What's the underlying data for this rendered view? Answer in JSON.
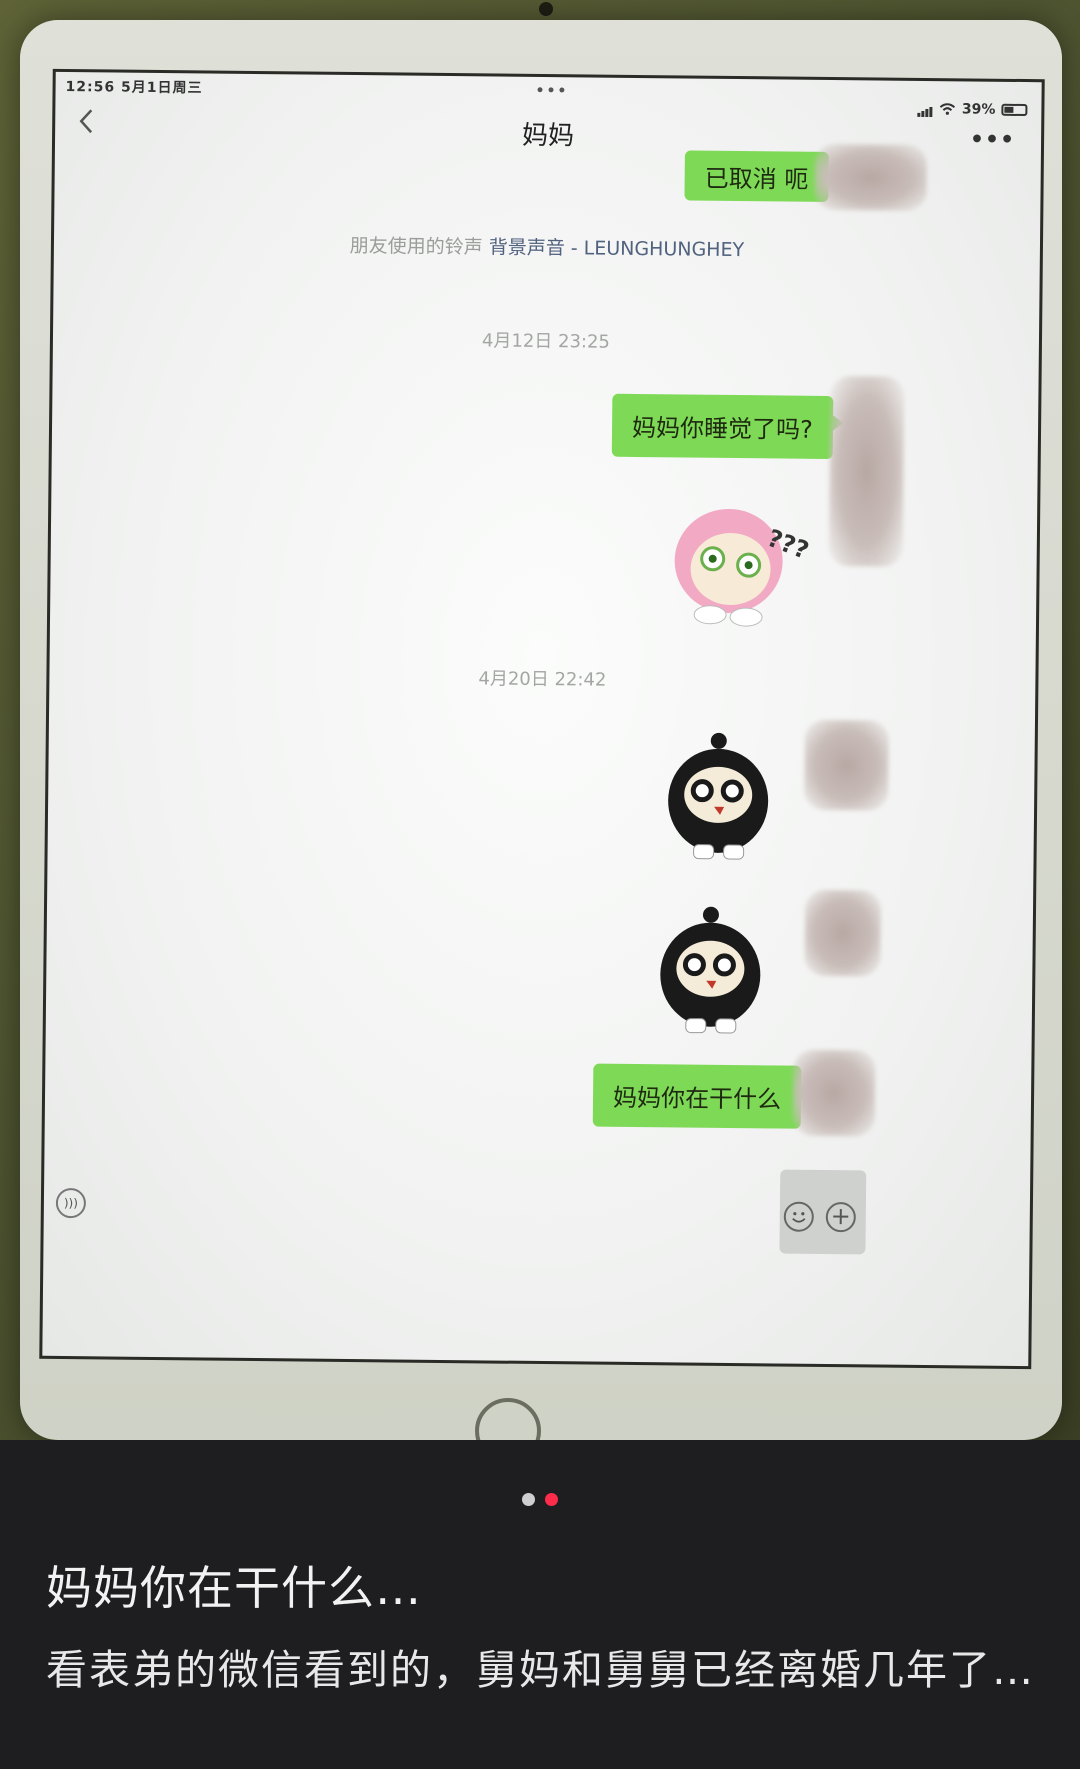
{
  "status_bar": {
    "time": "12:56  5月1日周三",
    "battery": "39%",
    "multitask": "•••"
  },
  "chat": {
    "title": "妈妈",
    "top_bubble": "已取消 呃",
    "system_note_prefix": "朋友使用的铃声",
    "system_note_link": "背景声音 - LEUNGHUNGHEY",
    "timestamp_1": "4月12日 23:25",
    "msg_1": "妈妈你睡觉了吗?",
    "timestamp_2": "4月20日 22:42",
    "msg_2": "妈妈你在干什么",
    "sticker_question_text": "???"
  },
  "post": {
    "title": "妈妈你在干什么…",
    "body": "看表弟的微信看到的，舅妈和舅舅已经离婚几年了…",
    "page_count": 2,
    "active_page": 2
  },
  "colors": {
    "bubble": "#7ed957",
    "pager_active": "#ff2b4a",
    "caption_bg": "#1e1e21"
  }
}
